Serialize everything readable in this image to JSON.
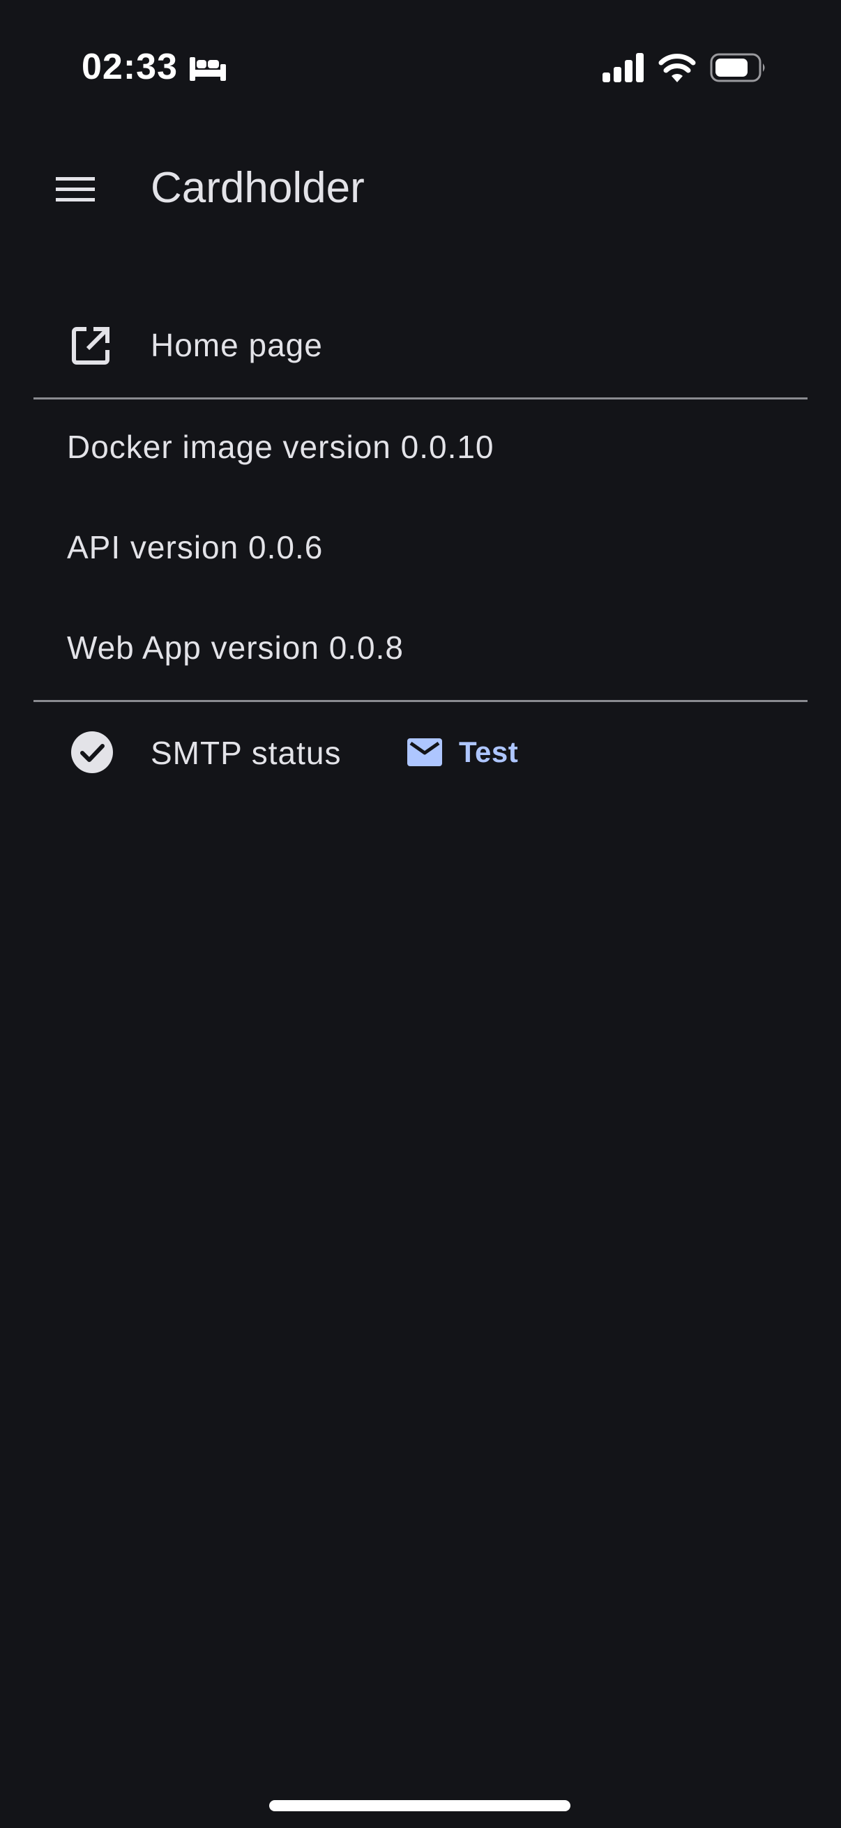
{
  "status_bar": {
    "time": "02:33",
    "icons": [
      "sleep-icon",
      "cellular-signal-icon",
      "wifi-icon",
      "battery-icon"
    ]
  },
  "app_bar": {
    "title": "Cardholder",
    "menu_icon": "hamburger-menu-icon"
  },
  "content": {
    "home_link": {
      "label": "Home page",
      "icon": "open-in-new-icon"
    },
    "versions": {
      "docker": "Docker image version 0.0.10",
      "api": "API version 0.0.6",
      "web_app": "Web App version 0.0.8"
    },
    "smtp": {
      "label": "SMTP status",
      "status_icon": "check-circle-icon",
      "test_button_label": "Test",
      "test_button_icon": "mail-icon"
    }
  },
  "colors": {
    "background": "#131418",
    "text": "#e3e3e8",
    "accent": "#aec6ff",
    "divider": "#8a8b90"
  }
}
